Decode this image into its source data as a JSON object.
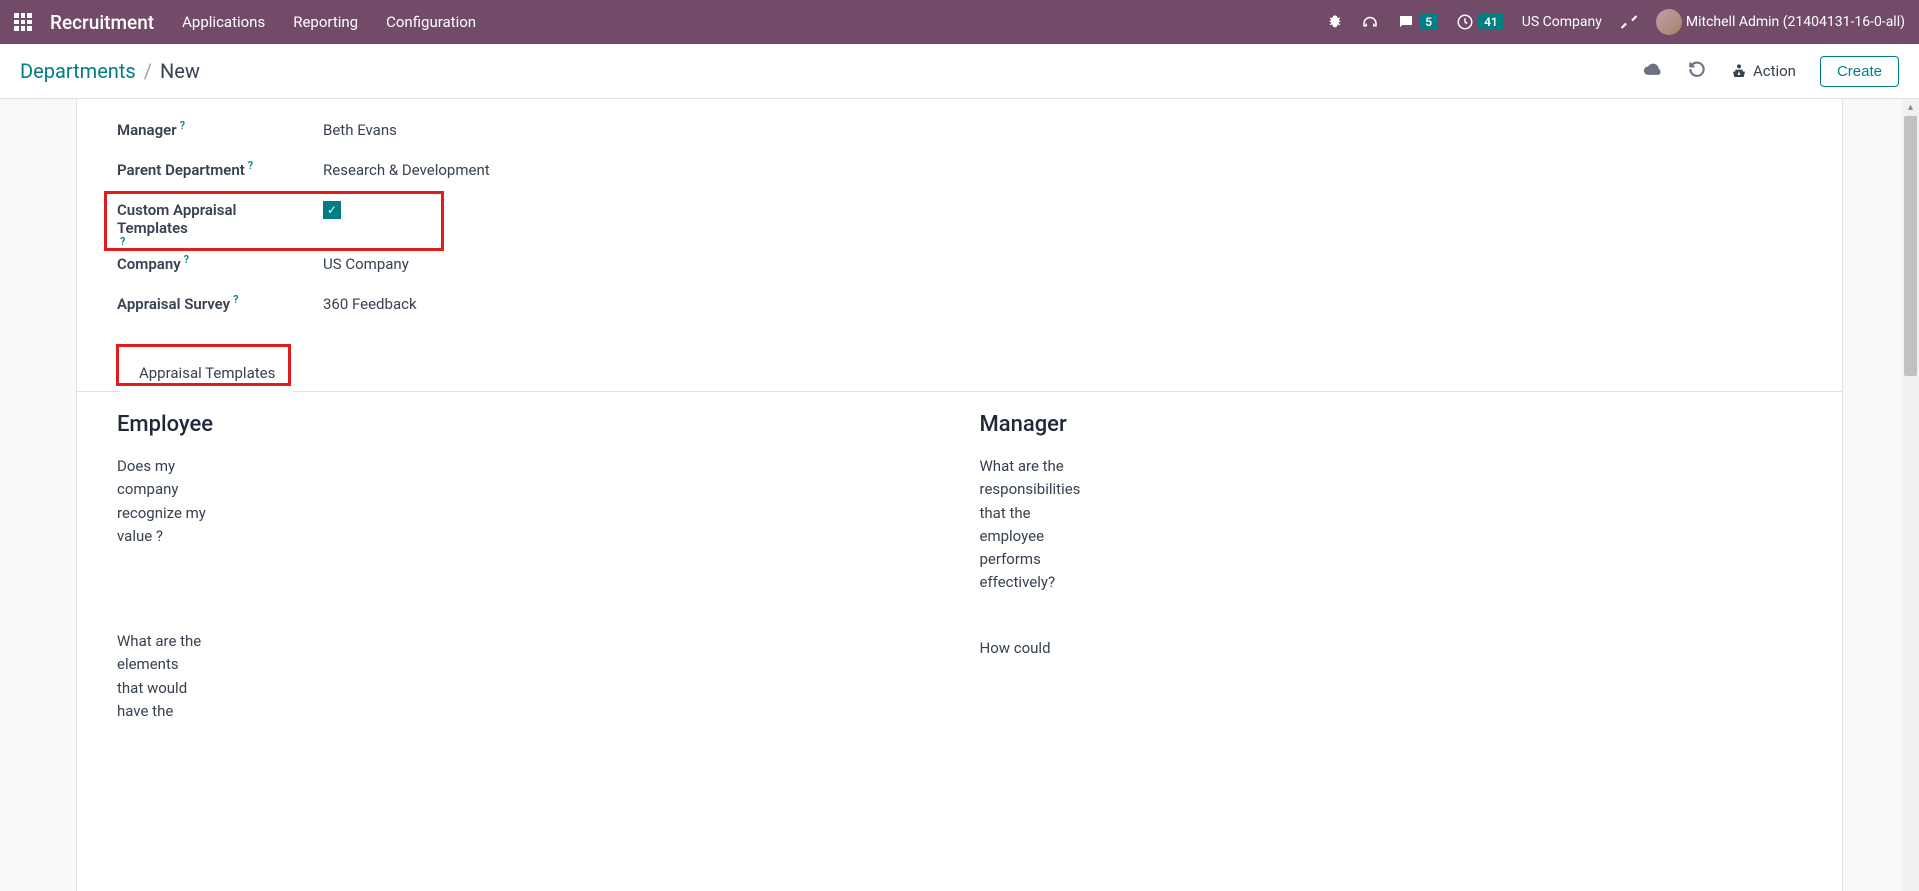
{
  "topbar": {
    "brand": "Recruitment",
    "nav": [
      "Applications",
      "Reporting",
      "Configuration"
    ],
    "chat_count": "5",
    "clock_count": "41",
    "company": "US Company",
    "user": "Mitchell Admin (21404131-16-0-all)"
  },
  "breadcrumb": {
    "root": "Departments",
    "sep": "/",
    "current": "New"
  },
  "actions": {
    "action_label": "Action",
    "create_label": "Create"
  },
  "fields": {
    "manager": {
      "label": "Manager",
      "value": "Beth Evans"
    },
    "parent_dept": {
      "label": "Parent Department",
      "value": "Research & Development"
    },
    "custom_templates": {
      "label": "Custom Appraisal Templates",
      "checked": true
    },
    "company": {
      "label": "Company",
      "value": "US Company"
    },
    "appraisal_survey": {
      "label": "Appraisal Survey",
      "value": "360 Feedback"
    }
  },
  "tab": {
    "label": "Appraisal Templates"
  },
  "templates": {
    "employee": {
      "title": "Employee",
      "q1": "Does my company recognize my value ?",
      "q2": "What are the elements that would have the"
    },
    "manager": {
      "title": "Manager",
      "q1": "What are the responsibilities that the employee performs effectively?",
      "q2": "How could"
    }
  }
}
